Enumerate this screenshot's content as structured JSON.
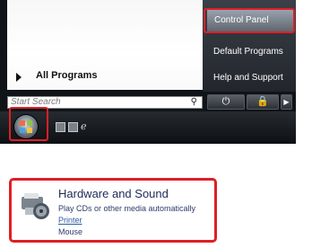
{
  "start_menu": {
    "all_programs": "All Programs",
    "search_placeholder": "Start Search",
    "right_items": [
      "Control Panel",
      "Default Programs",
      "Help and Support"
    ],
    "power_glyph": "⏻",
    "lock_glyph": "🔒",
    "arrow_glyph": "▶"
  },
  "control_panel": {
    "category_title": "Hardware and Sound",
    "category_description": "Play CDs or other media automatically",
    "links": [
      "Printer",
      "Mouse"
    ]
  },
  "colors": {
    "highlight_red": "#e01f26",
    "menu_dark": "#22262c",
    "link_blue": "#2d5aa6"
  }
}
